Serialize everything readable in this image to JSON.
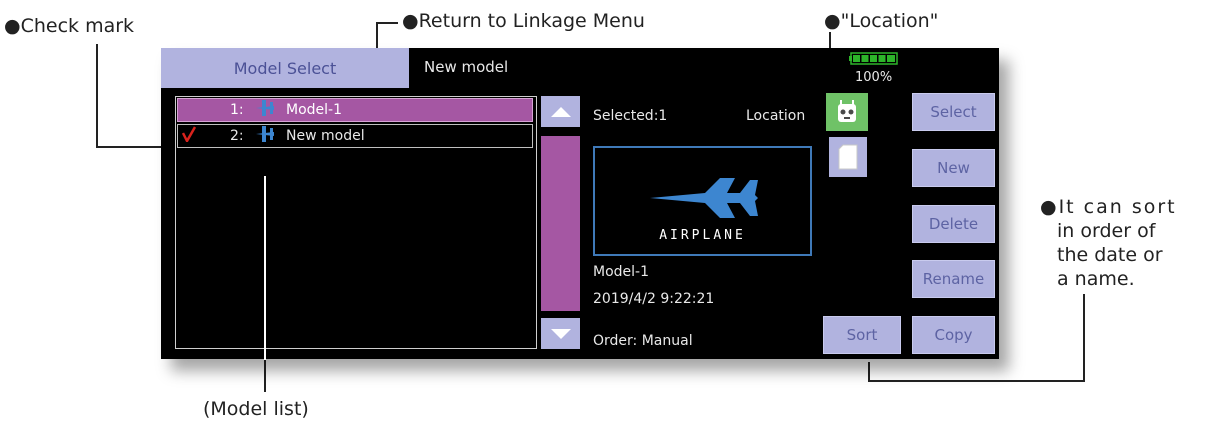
{
  "annotations": {
    "check_mark": "●Check mark",
    "return_to_linkage": "●Return to Linkage Menu",
    "location": "●\"Location\"",
    "sort_note_1": "●It can sort",
    "sort_note_2": "in order of",
    "sort_note_3": "the date or",
    "sort_note_4": "a name.",
    "model_list": "(Model list)"
  },
  "header": {
    "tab_label": "Model Select",
    "current_model": "New model",
    "battery_percent": "100%"
  },
  "model_list": [
    {
      "number": "1:",
      "name": "Model-1",
      "selected": true,
      "checked": false
    },
    {
      "number": "2:",
      "name": "New model",
      "selected": false,
      "checked": true
    }
  ],
  "info": {
    "selected_text": "Selected:1",
    "location_label": "Location",
    "preview_type": "AIRPLANE",
    "model_name": "Model-1",
    "datetime": "2019/4/2  9:22:21",
    "order_text": "Order: Manual"
  },
  "buttons": {
    "select": "Select",
    "new": "New",
    "delete": "Delete",
    "rename": "Rename",
    "copy": "Copy",
    "sort": "Sort"
  },
  "colors": {
    "accent": "#b1b3df",
    "selected_row": "#a557a3",
    "scroll_thumb": "#a557a3",
    "location_active": "#6fc267",
    "battery": "#2db52a",
    "model_icon": "#3d86d0",
    "check_mark": "#d9231d"
  },
  "icons": {
    "location_transmitter": "transmitter-icon",
    "location_sdcard": "sd-card-icon",
    "model_type": "airplane-icon"
  }
}
